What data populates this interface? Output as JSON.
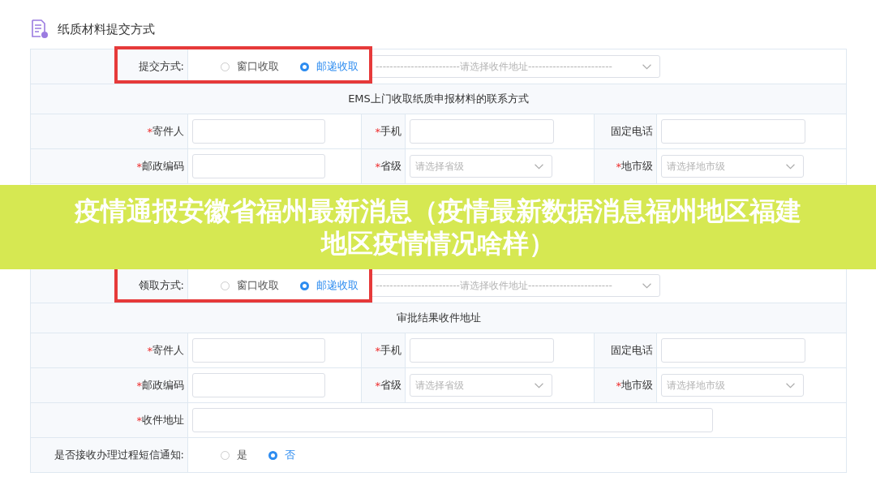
{
  "sections": [
    {
      "title": "纸质材料提交方式",
      "highlighted": true,
      "method": {
        "label": "提交方式:",
        "options": [
          {
            "label": "窗口收取",
            "selected": false
          },
          {
            "label": "邮递收取",
            "selected": true
          }
        ],
        "select_placeholder": "------------------------请选择收件地址------------------------"
      },
      "subtitle": "EMS上门收取纸质申报材料的联系方式",
      "rows": [
        {
          "kind": "fields",
          "fields": [
            {
              "mark": "*",
              "label": "寄件人",
              "kind": "input"
            },
            {
              "mark": "*",
              "label": "手机",
              "kind": "input"
            },
            {
              "label": "固定电话",
              "kind": "input"
            }
          ]
        },
        {
          "kind": "fields",
          "fields": [
            {
              "mark": "*",
              "label": "邮政编码",
              "kind": "input"
            },
            {
              "mark": "*",
              "label": "省级",
              "kind": "select",
              "placeholder": "请选择省级"
            },
            {
              "mark": "*",
              "label": "地市级",
              "kind": "select",
              "placeholder": "请选择地市级"
            }
          ]
        }
      ]
    },
    {
      "highlighted": true,
      "method": {
        "label": "领取方式:",
        "options": [
          {
            "label": "窗口收取",
            "selected": false
          },
          {
            "label": "邮递收取",
            "selected": true
          }
        ],
        "select_placeholder": "------------------------请选择收件地址------------------------"
      },
      "subtitle": "审批结果收件地址",
      "rows": [
        {
          "kind": "fields",
          "fields": [
            {
              "mark": "*",
              "label": "寄件人",
              "kind": "input"
            },
            {
              "mark": "*",
              "label": "手机",
              "kind": "input"
            },
            {
              "label": "固定电话",
              "kind": "input"
            }
          ]
        },
        {
          "kind": "fields",
          "fields": [
            {
              "mark": "*",
              "label": "邮政编码",
              "kind": "input"
            },
            {
              "mark": "*",
              "label": "省级",
              "kind": "select",
              "placeholder": "请选择省级"
            },
            {
              "mark": "*",
              "label": "地市级",
              "kind": "select",
              "placeholder": "请选择地市级"
            }
          ]
        },
        {
          "kind": "fields",
          "fields": [
            {
              "mark": "*",
              "label": "收件地址",
              "kind": "input"
            }
          ]
        },
        {
          "kind": "radio",
          "label": "是否接收办理过程短信通知:",
          "options": [
            {
              "label": "是",
              "selected": false
            },
            {
              "label": "否",
              "selected": true
            }
          ]
        }
      ]
    }
  ],
  "banner": {
    "title": "疫情通报安徽省福州最新消息（疫情最新数据消息福州地区福建地区疫情情况啥样）"
  }
}
